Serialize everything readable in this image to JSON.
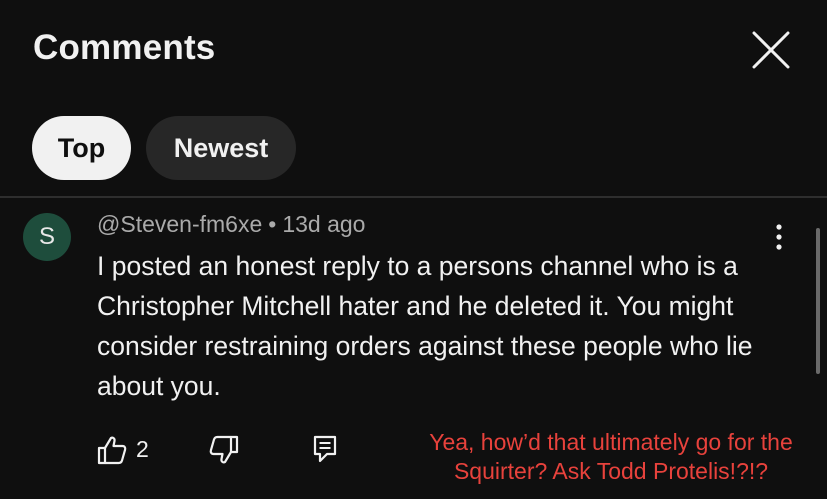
{
  "header": {
    "title": "Comments"
  },
  "filters": {
    "top_label": "Top",
    "newest_label": "Newest",
    "selected": "Top"
  },
  "comment": {
    "avatar_letter": "S",
    "author": "@Steven-fm6xe",
    "separator": "•",
    "time": "13d ago",
    "text": "I posted an honest reply to a persons channel who is a Christopher Mitchell hater and he deleted it. You might consider restraining orders against these people who lie about you.",
    "like_count": "2"
  },
  "overlay": {
    "line1": "Yea, how’d that ultimately go for the",
    "line2": "Squirter? Ask Todd Protelis!?!?"
  },
  "colors": {
    "background": "#0f0f0f",
    "chip_selected": "#f1f1f1",
    "chip_unselected": "#272727",
    "avatar": "#1e4d3c",
    "overlay_text": "#e8423c",
    "meta_text": "#aaaaaa"
  },
  "icons": {
    "close": "close-icon",
    "more": "more-vert-icon",
    "like": "thumb-up-icon",
    "dislike": "thumb-down-icon",
    "reply": "comment-reply-icon"
  }
}
